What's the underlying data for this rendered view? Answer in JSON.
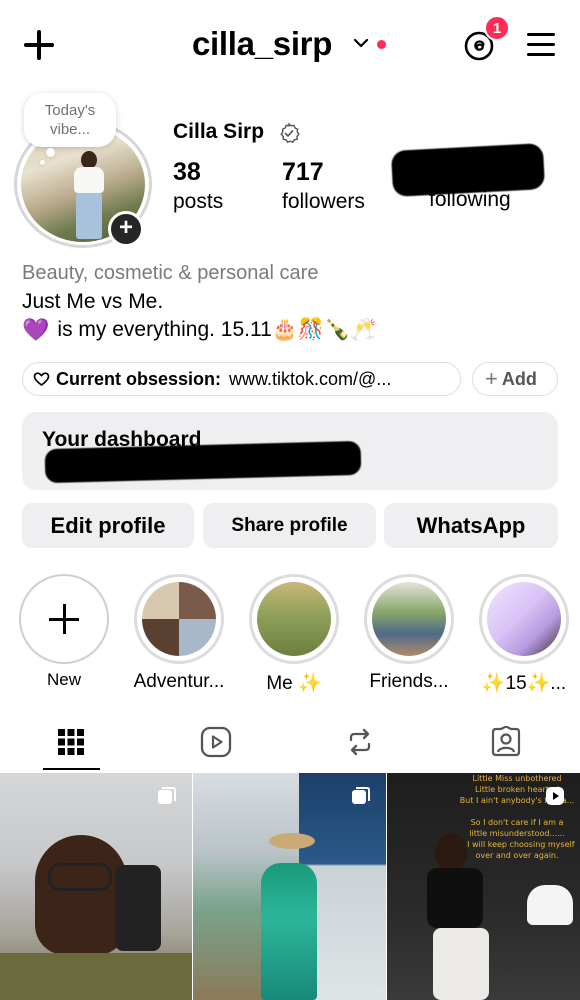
{
  "header": {
    "username": "cilla_sirp",
    "threads_badge": "1",
    "icons": [
      "plus-icon",
      "chevron-down-icon",
      "threads-icon",
      "menu-icon"
    ]
  },
  "profile": {
    "note": "Today's vibe...",
    "full_name": "Cilla Sirp",
    "stats": {
      "posts": {
        "value": "38",
        "label": "posts"
      },
      "followers": {
        "value": "717",
        "label": "followers"
      },
      "following": {
        "value": "",
        "label": "following"
      }
    },
    "category": "Beauty, cosmetic & personal care",
    "bio_line1": "Just Me vs Me.",
    "bio_line2_emoji": "💜",
    "bio_line2": "is my everything. 15.11🎂🎊🍾🥂",
    "obsession_label": "Current obsession:",
    "obsession_value": "www.tiktok.com/@...",
    "add_label": "Add"
  },
  "dashboard": {
    "title": "Your dashboard"
  },
  "actions": {
    "edit": "Edit profile",
    "share": "Share profile",
    "whatsapp": "WhatsApp"
  },
  "highlights": [
    {
      "label": "New"
    },
    {
      "label": "Adventur..."
    },
    {
      "label": "Me ✨"
    },
    {
      "label": "Friends..."
    },
    {
      "label": "✨15✨..."
    }
  ],
  "tabs": [
    "grid-icon",
    "reels-icon",
    "reposts-icon",
    "tagged-icon"
  ],
  "reel_caption": "Little Miss unbothered\nLittle broken hearted\nBut I ain't anybody's fool a...\n\nSo I don't care if I am a\nlittle misunderstood......\n...I will keep choosing myself\nover and over again.",
  "colors": {
    "notification": "#ff2d55",
    "button_bg": "#efeff2",
    "category_text": "#7a7a7a",
    "caption_text": "#e8b43a"
  }
}
